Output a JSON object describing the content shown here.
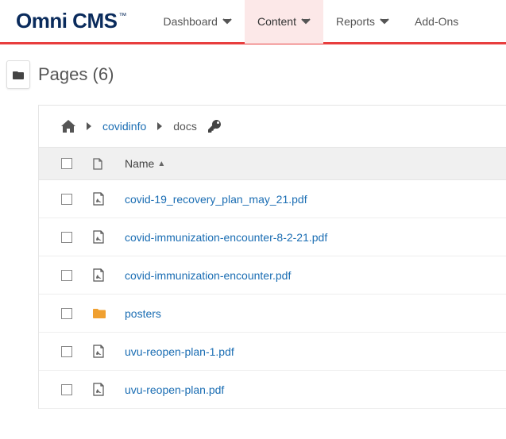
{
  "brand": {
    "name": "Omni CMS",
    "tm": "™"
  },
  "nav": {
    "items": [
      {
        "label": "Dashboard",
        "active": false,
        "caret": true
      },
      {
        "label": "Content",
        "active": true,
        "caret": true
      },
      {
        "label": "Reports",
        "active": false,
        "caret": true
      },
      {
        "label": "Add-Ons",
        "active": false,
        "caret": false
      }
    ]
  },
  "page": {
    "title": "Pages",
    "count": "(6)"
  },
  "breadcrumb": {
    "home_icon": "home",
    "segments": [
      {
        "label": "covidinfo",
        "link": true
      },
      {
        "label": "docs",
        "link": false
      }
    ],
    "trailing_icon": "key"
  },
  "table": {
    "columns": {
      "name": "Name"
    },
    "sort": {
      "column": "name",
      "direction": "asc"
    },
    "rows": [
      {
        "type": "pdf",
        "name": "covid-19_recovery_plan_may_21.pdf"
      },
      {
        "type": "pdf",
        "name": "covid-immunization-encounter-8-2-21.pdf"
      },
      {
        "type": "pdf",
        "name": "covid-immunization-encounter.pdf"
      },
      {
        "type": "folder",
        "name": "posters"
      },
      {
        "type": "pdf",
        "name": "uvu-reopen-plan-1.pdf"
      },
      {
        "type": "pdf",
        "name": "uvu-reopen-plan.pdf"
      }
    ]
  }
}
